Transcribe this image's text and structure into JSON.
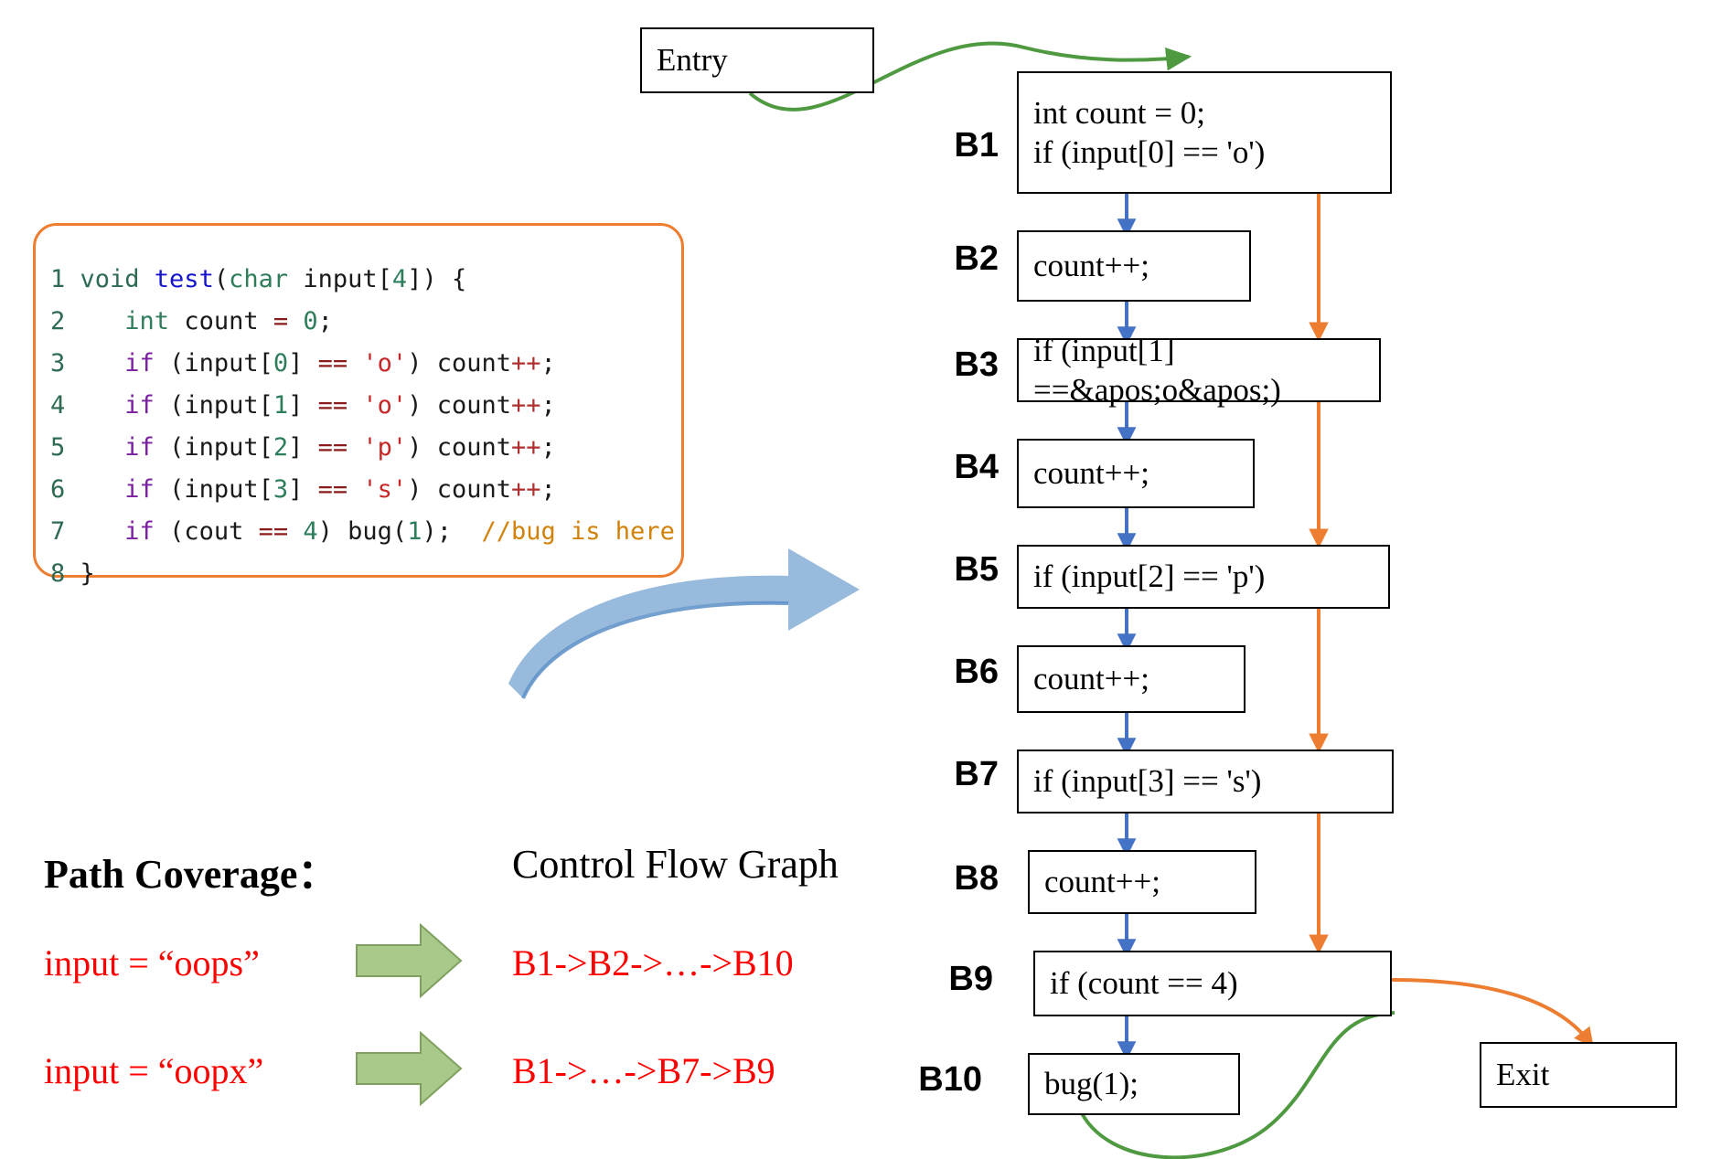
{
  "code_panel": {
    "border_color": "#ED7D31",
    "lines": [
      {
        "num": "1",
        "indent": 0,
        "tokens": [
          {
            "t": "void ",
            "c": "kw-void"
          },
          {
            "t": "test",
            "c": "fn"
          },
          {
            "t": "(",
            "c": "plain"
          },
          {
            "t": "char",
            "c": "kw-type"
          },
          {
            "t": " input[",
            "c": "plain"
          },
          {
            "t": "4",
            "c": "num"
          },
          {
            "t": "]) {",
            "c": "plain"
          }
        ]
      },
      {
        "num": "2",
        "indent": 1,
        "tokens": [
          {
            "t": "int",
            "c": "kw-type"
          },
          {
            "t": " count ",
            "c": "plain"
          },
          {
            "t": "=",
            "c": "op"
          },
          {
            "t": " ",
            "c": "plain"
          },
          {
            "t": "0",
            "c": "num"
          },
          {
            "t": ";",
            "c": "plain"
          }
        ]
      },
      {
        "num": "3",
        "indent": 1,
        "tokens": [
          {
            "t": "if",
            "c": "kw-if"
          },
          {
            "t": " (input[",
            "c": "plain"
          },
          {
            "t": "0",
            "c": "num"
          },
          {
            "t": "] ",
            "c": "plain"
          },
          {
            "t": "==",
            "c": "op"
          },
          {
            "t": " ",
            "c": "plain"
          },
          {
            "t": "'o'",
            "c": "str"
          },
          {
            "t": ") count",
            "c": "plain"
          },
          {
            "t": "++",
            "c": "inc"
          },
          {
            "t": ";",
            "c": "plain"
          }
        ]
      },
      {
        "num": "4",
        "indent": 1,
        "tokens": [
          {
            "t": "if",
            "c": "kw-if"
          },
          {
            "t": " (input[",
            "c": "plain"
          },
          {
            "t": "1",
            "c": "num"
          },
          {
            "t": "] ",
            "c": "plain"
          },
          {
            "t": "==",
            "c": "op"
          },
          {
            "t": " ",
            "c": "plain"
          },
          {
            "t": "'o'",
            "c": "str"
          },
          {
            "t": ") count",
            "c": "plain"
          },
          {
            "t": "++",
            "c": "inc"
          },
          {
            "t": ";",
            "c": "plain"
          }
        ]
      },
      {
        "num": "5",
        "indent": 1,
        "tokens": [
          {
            "t": "if",
            "c": "kw-if"
          },
          {
            "t": " (input[",
            "c": "plain"
          },
          {
            "t": "2",
            "c": "num"
          },
          {
            "t": "] ",
            "c": "plain"
          },
          {
            "t": "==",
            "c": "op"
          },
          {
            "t": " ",
            "c": "plain"
          },
          {
            "t": "'p'",
            "c": "str"
          },
          {
            "t": ") count",
            "c": "plain"
          },
          {
            "t": "++",
            "c": "inc"
          },
          {
            "t": ";",
            "c": "plain"
          }
        ]
      },
      {
        "num": "6",
        "indent": 1,
        "tokens": [
          {
            "t": "if",
            "c": "kw-if"
          },
          {
            "t": " (input[",
            "c": "plain"
          },
          {
            "t": "3",
            "c": "num"
          },
          {
            "t": "] ",
            "c": "plain"
          },
          {
            "t": "==",
            "c": "op"
          },
          {
            "t": " ",
            "c": "plain"
          },
          {
            "t": "'s'",
            "c": "str"
          },
          {
            "t": ") count",
            "c": "plain"
          },
          {
            "t": "++",
            "c": "inc"
          },
          {
            "t": ";",
            "c": "plain"
          }
        ]
      },
      {
        "num": "7",
        "indent": 1,
        "tokens": [
          {
            "t": "if",
            "c": "kw-if"
          },
          {
            "t": " (cout ",
            "c": "plain"
          },
          {
            "t": "==",
            "c": "op"
          },
          {
            "t": " ",
            "c": "plain"
          },
          {
            "t": "4",
            "c": "num"
          },
          {
            "t": ") bug(",
            "c": "plain"
          },
          {
            "t": "1",
            "c": "num"
          },
          {
            "t": ");  ",
            "c": "plain"
          },
          {
            "t": "//bug is here",
            "c": "cmt"
          }
        ]
      },
      {
        "num": "8",
        "indent": 0,
        "tokens": [
          {
            "t": "}",
            "c": "plain"
          }
        ]
      }
    ]
  },
  "cfg": {
    "entry_label": "Entry",
    "exit_label": "Exit",
    "title": "Control Flow Graph",
    "edge_colors": {
      "entry": "#4F9A41",
      "fallthrough": "#4472C4",
      "branch_taken": "#ED7D31",
      "back_edge": "#4F9A41"
    },
    "blocks": [
      {
        "id": "B1",
        "line1": "int count = 0;",
        "line2": "if (input[0] == 'o')"
      },
      {
        "id": "B2",
        "line1": "count++;",
        "line2": ""
      },
      {
        "id": "B3",
        "line1": "if (input[1] ==&apos;o&apos;)",
        "line2": ""
      },
      {
        "id": "B4",
        "line1": "count++;",
        "line2": ""
      },
      {
        "id": "B5",
        "line1": "if (input[2] == 'p')",
        "line2": ""
      },
      {
        "id": "B6",
        "line1": "count++;",
        "line2": ""
      },
      {
        "id": "B7",
        "line1": "if (input[3] == 's')",
        "line2": ""
      },
      {
        "id": "B8",
        "line1": "count++;",
        "line2": ""
      },
      {
        "id": "B9",
        "line1": "if (count == 4)",
        "line2": ""
      },
      {
        "id": "B10",
        "line1": "bug(1);",
        "line2": ""
      }
    ]
  },
  "path_coverage": {
    "title": "Path Coverage：",
    "rows": [
      {
        "input": "input = “oops”",
        "path": "B1->B2->…->B10"
      },
      {
        "input": "input = “oopx”",
        "path": "B1->…->B7->B9"
      }
    ],
    "arrow_color": "#A9C98A"
  }
}
